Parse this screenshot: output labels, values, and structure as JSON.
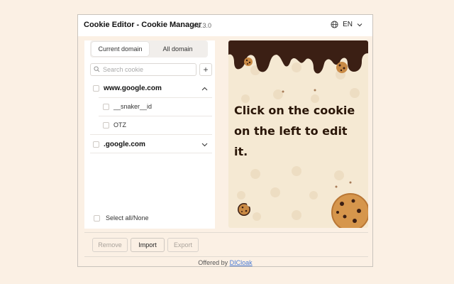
{
  "header": {
    "title": "Cookie Editor - Cookie Manager",
    "version": "V2.3.0",
    "language": "EN"
  },
  "tabs": [
    {
      "label": "Current domain",
      "active": true
    },
    {
      "label": "All domain",
      "active": false
    }
  ],
  "search": {
    "placeholder": "Search cookie",
    "value": ""
  },
  "domains": [
    {
      "name": "www.google.com",
      "expanded": true,
      "cookies": [
        "__snaker__id",
        "OTZ"
      ]
    },
    {
      "name": ".google.com",
      "expanded": false,
      "cookies": []
    }
  ],
  "select_all_label": "Select all/None",
  "illustration": {
    "message": "Click on the cookie on the left to edit it.",
    "background": "#f5e9d3",
    "drip_color": "#3b1f14"
  },
  "actions": {
    "remove": "Remove",
    "import": "Import",
    "export": "Export"
  },
  "footer": {
    "prefix": "Offered by",
    "link_text": "DICloak"
  },
  "colors": {
    "page_background": "#fbf0e4",
    "link": "#4a7bd6"
  }
}
